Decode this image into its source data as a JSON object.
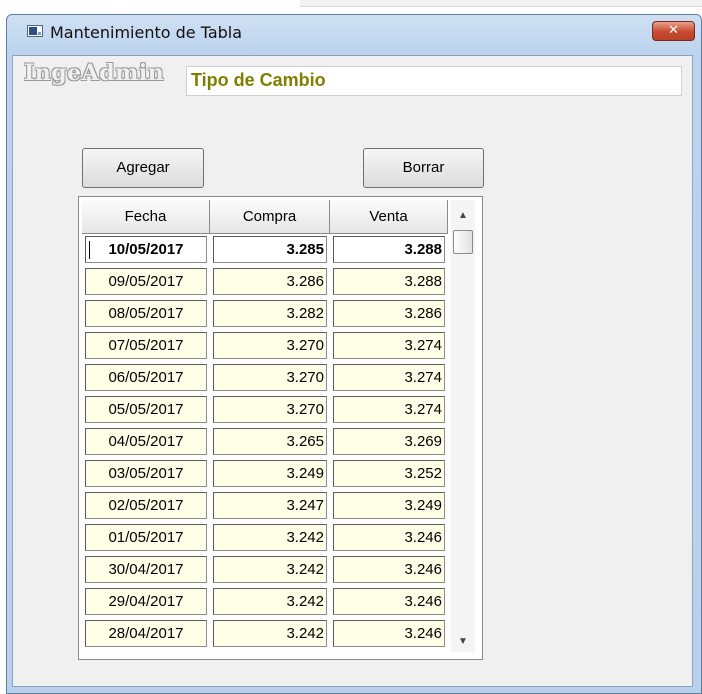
{
  "window": {
    "title": "Mantenimiento de Tabla",
    "close_label": "✕"
  },
  "brand": {
    "text": "IngeAdmin"
  },
  "header": {
    "title": "Tipo de Cambio",
    "title_color": "#808000"
  },
  "toolbar": {
    "add_label": "Agregar",
    "delete_label": "Borrar"
  },
  "table": {
    "columns": [
      "Fecha",
      "Compra",
      "Venta"
    ],
    "rows": [
      [
        "10/05/2017",
        "3.285",
        "3.288"
      ],
      [
        "09/05/2017",
        "3.286",
        "3.288"
      ],
      [
        "08/05/2017",
        "3.282",
        "3.286"
      ],
      [
        "07/05/2017",
        "3.270",
        "3.274"
      ],
      [
        "06/05/2017",
        "3.270",
        "3.274"
      ],
      [
        "05/05/2017",
        "3.270",
        "3.274"
      ],
      [
        "04/05/2017",
        "3.265",
        "3.269"
      ],
      [
        "03/05/2017",
        "3.249",
        "3.252"
      ],
      [
        "02/05/2017",
        "3.247",
        "3.249"
      ],
      [
        "01/05/2017",
        "3.242",
        "3.246"
      ],
      [
        "30/04/2017",
        "3.242",
        "3.246"
      ],
      [
        "29/04/2017",
        "3.242",
        "3.246"
      ],
      [
        "28/04/2017",
        "3.242",
        "3.246"
      ]
    ]
  },
  "scrollbar": {
    "up_glyph": "▲",
    "down_glyph": "▼"
  }
}
